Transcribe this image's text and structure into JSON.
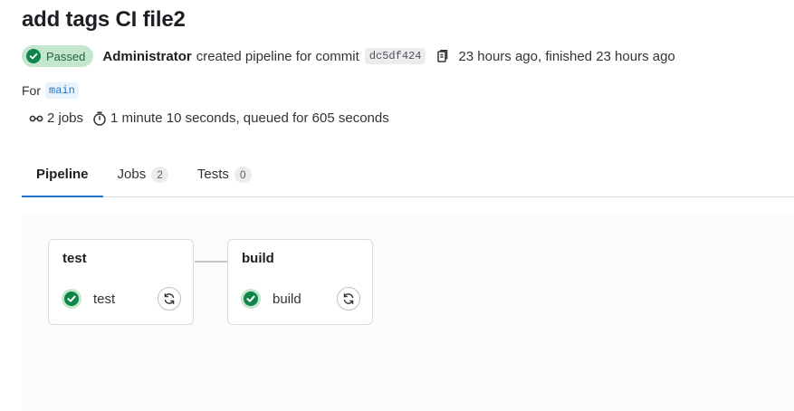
{
  "pipeline": {
    "title": "add tags CI file2",
    "status": "Passed",
    "author": "Administrator",
    "action_text": "created pipeline for commit",
    "commit_sha": "dc5df424",
    "timing_text": "23 hours ago, finished 23 hours ago",
    "for_label": "For",
    "ref": "main",
    "jobs_count_text": "2 jobs",
    "duration_text": "1 minute 10 seconds, queued for 605 seconds"
  },
  "tabs": [
    {
      "label": "Pipeline",
      "count": ""
    },
    {
      "label": "Jobs",
      "count": "2"
    },
    {
      "label": "Tests",
      "count": "0"
    }
  ],
  "stages": [
    {
      "name": "test",
      "jobs": [
        {
          "name": "test",
          "status": "passed"
        }
      ]
    },
    {
      "name": "build",
      "jobs": [
        {
          "name": "build",
          "status": "passed"
        }
      ]
    }
  ],
  "colors": {
    "success": "#108548",
    "success_bg": "#c3e6cd",
    "active_tab": "#1f75cb"
  },
  "icons": {
    "status": "check-circle-icon",
    "copy": "copy-icon",
    "jobs": "pipeline-icon",
    "duration": "timer-icon",
    "retry": "retry-icon"
  }
}
